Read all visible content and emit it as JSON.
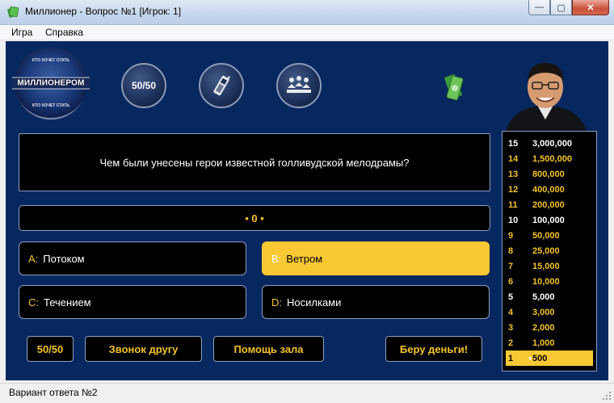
{
  "window": {
    "title": "Миллионер - Вопрос №1 [Игрок: 1]",
    "controls": [
      "—",
      "▢",
      "✕"
    ]
  },
  "menu": [
    "Игра",
    "Справка"
  ],
  "logo": {
    "top_text": "КТО ХОЧЕТ СТАТЬ",
    "main_text": "МИЛЛИОНЕРОМ",
    "bottom_text": "КТО ХОЧЕТ СТАТЬ"
  },
  "lifelines": {
    "fifty_fifty": "50/50",
    "phone_icon": "phone-icon",
    "audience_icon": "audience-icon"
  },
  "question": {
    "text": "Чем были унесены герои известной голливудской мелодрамы?"
  },
  "timer": {
    "text": "• 0 •"
  },
  "answers": [
    {
      "letter": "A:",
      "text": "Потоком",
      "selected": false
    },
    {
      "letter": "B:",
      "text": "Ветром",
      "selected": true
    },
    {
      "letter": "C:",
      "text": "Течением",
      "selected": false
    },
    {
      "letter": "D:",
      "text": "Носилками",
      "selected": false
    }
  ],
  "buttons": {
    "fifty": "50/50",
    "phone": "Звонок другу",
    "audience": "Помощь зала",
    "take_money": "Беру деньги!"
  },
  "ladder": [
    {
      "num": "15",
      "amount": "3,000,000",
      "milestone": true
    },
    {
      "num": "14",
      "amount": "1,500,000",
      "milestone": false
    },
    {
      "num": "13",
      "amount": "800,000",
      "milestone": false
    },
    {
      "num": "12",
      "amount": "400,000",
      "milestone": false
    },
    {
      "num": "11",
      "amount": "200,000",
      "milestone": false
    },
    {
      "num": "10",
      "amount": "100,000",
      "milestone": true
    },
    {
      "num": "9",
      "amount": "50,000",
      "milestone": false
    },
    {
      "num": "8",
      "amount": "25,000",
      "milestone": false
    },
    {
      "num": "7",
      "amount": "15,000",
      "milestone": false
    },
    {
      "num": "6",
      "amount": "10,000",
      "milestone": false
    },
    {
      "num": "5",
      "amount": "5,000",
      "milestone": true
    },
    {
      "num": "4",
      "amount": "3,000",
      "milestone": false
    },
    {
      "num": "3",
      "amount": "2,000",
      "milestone": false
    },
    {
      "num": "2",
      "amount": "1,000",
      "milestone": false
    },
    {
      "num": "1",
      "amount": "500",
      "milestone": false,
      "current": true
    }
  ],
  "status": {
    "text": "Вариант ответа №2"
  },
  "colors": {
    "background": "#07275f",
    "accent": "#f3c22c",
    "selected": "#f9c833"
  }
}
